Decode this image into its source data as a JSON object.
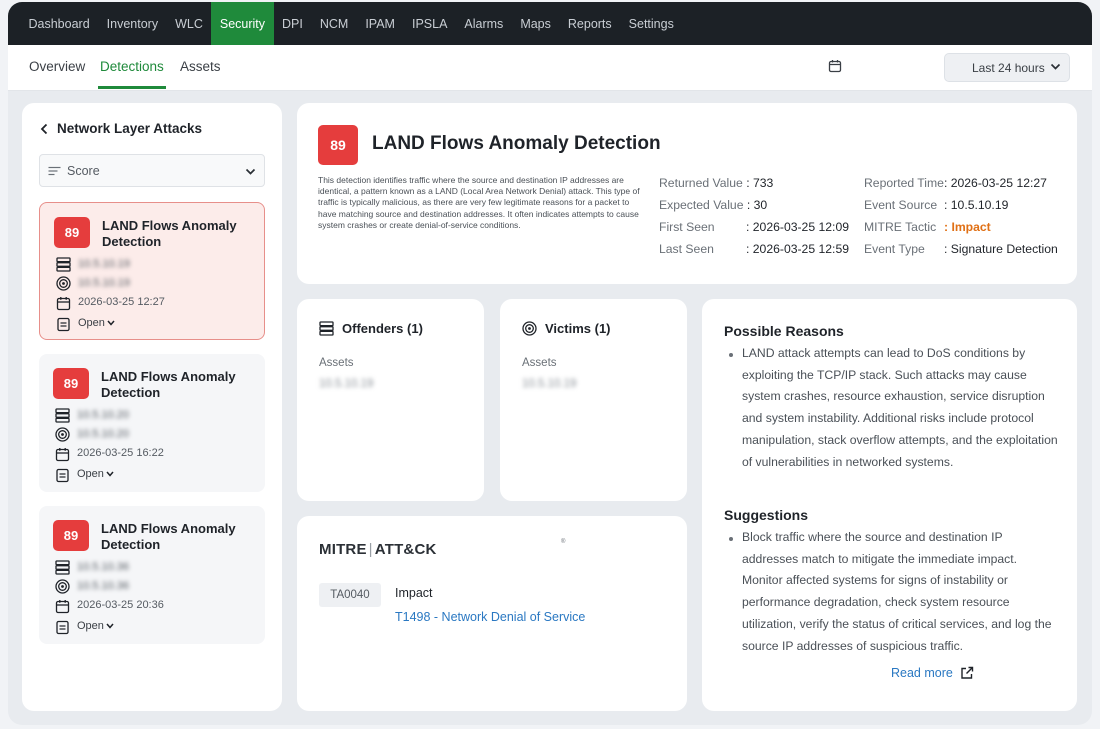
{
  "topnav": {
    "items": [
      "Dashboard",
      "Inventory",
      "WLC",
      "Security",
      "DPI",
      "NCM",
      "IPAM",
      "IPSLA",
      "Alarms",
      "Maps",
      "Reports",
      "Settings"
    ],
    "active": "Security"
  },
  "subnav": {
    "tabs": [
      "Overview",
      "Detections",
      "Assets"
    ],
    "active": "Detections",
    "time_range": "Last 24 hours"
  },
  "sidebar": {
    "title": "Network Layer Attacks",
    "sort_label": "Score",
    "cards": [
      {
        "score": "89",
        "title": "LAND Flows Anomaly Detection",
        "source": "10.5.10.19",
        "target": "10.5.10.19",
        "time": "2026-03-25 12:27",
        "status": "Open"
      },
      {
        "score": "89",
        "title": "LAND Flows Anomaly Detection",
        "source": "10.5.10.20",
        "target": "10.5.10.20",
        "time": "2026-03-25 16:22",
        "status": "Open"
      },
      {
        "score": "89",
        "title": "LAND Flows Anomaly Detection",
        "source": "10.5.10.36",
        "target": "10.5.10.36",
        "time": "2026-03-25 20:36",
        "status": "Open"
      }
    ]
  },
  "detail": {
    "score": "89",
    "title": "LAND Flows Anomaly Detection",
    "description": "This detection identifies traffic where the source and destination IP addresses are identical, a pattern known as a LAND (Local Area Network Denial) attack. This type of traffic is typically malicious, as there are very few legitimate reasons for a packet to have matching source and destination addresses. It often indicates attempts to cause system crashes or create denial-of-service conditions.",
    "fields": {
      "returned_value_label": "Returned Value",
      "returned_value": ": 733",
      "expected_value_label": "Expected Value",
      "expected_value": ": 30",
      "first_seen_label": "First Seen",
      "first_seen": ": 2026-03-25 12:09",
      "last_seen_label": "Last Seen",
      "last_seen": ": 2026-03-25 12:59",
      "reported_time_label": "Reported Time",
      "reported_time": ": 2026-03-25 12:27",
      "event_source_label": "Event Source",
      "event_source": ": 10.5.10.19",
      "mitre_tactic_label": "MITRE Tactic",
      "mitre_tactic_sep": ": ",
      "mitre_tactic": "Impact",
      "event_type_label": "Event Type",
      "event_type": ": Signature Detection"
    }
  },
  "offenders": {
    "title": "Offenders (1)",
    "sub": "Assets",
    "value": "10.5.10.19"
  },
  "victims": {
    "title": "Victims (1)",
    "sub": "Assets",
    "value": "10.5.10.19"
  },
  "mitre": {
    "logo_left": "MITRE",
    "logo_sep": "|",
    "logo_right": "ATT&CK",
    "reg": "®",
    "tactic_id": "TA0040",
    "tactic_name": "Impact",
    "technique": "T1498 - Network Denial of Service"
  },
  "reasons": {
    "title": "Possible Reasons",
    "text": "LAND attack attempts can lead to DoS conditions by exploiting the TCP/IP stack. Such attacks may cause system crashes, resource exhaustion, service disruption and system instability. Additional risks include protocol manipulation, stack overflow attempts, and the exploitation of vulnerabilities in networked systems."
  },
  "suggestions": {
    "title": "Suggestions",
    "text": "Block traffic where the source and destination IP addresses match to mitigate the immediate impact. Monitor affected systems for signs of instability or performance degradation, check system resource utilization, verify the status of critical services, and log the source IP addresses of suspicious traffic.",
    "read_more": "Read more"
  },
  "colors": {
    "accent_green": "#1f8a3b",
    "score_red": "#e53d3d",
    "link_blue": "#2a78c2",
    "impact_orange": "#e07015"
  }
}
